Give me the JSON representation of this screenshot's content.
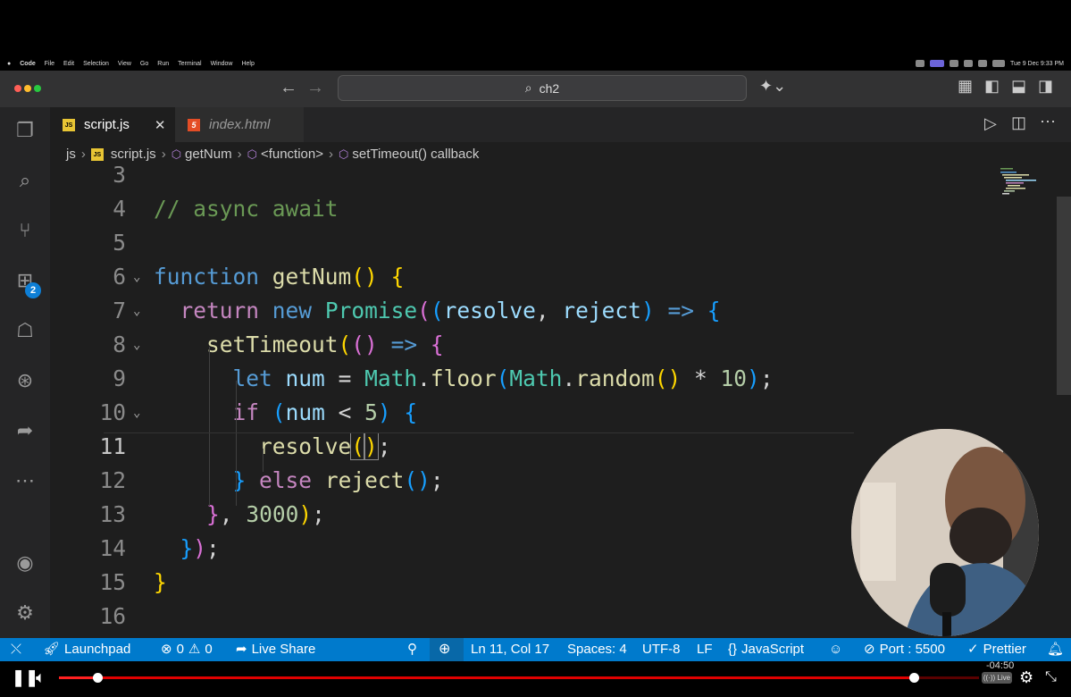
{
  "menubar": {
    "app": "Code",
    "items": [
      "File",
      "Edit",
      "Selection",
      "View",
      "Go",
      "Run",
      "Terminal",
      "Window",
      "Help"
    ],
    "clock": "Tue 9 Dec 9:33 PM"
  },
  "titlebar": {
    "search_text": "ch2"
  },
  "activity": {
    "extensions_badge": "2"
  },
  "tabs": [
    {
      "label": "script.js",
      "icon": "js-file-icon",
      "active": true,
      "close": "✕"
    },
    {
      "label": "index.html",
      "icon": "html5-file-icon",
      "active": false
    }
  ],
  "breadcrumb": [
    "js",
    "script.js",
    "getNum",
    "<function>",
    "setTimeout() callback"
  ],
  "editor": {
    "line_numbers": [
      "3",
      "4",
      "5",
      "6",
      "7",
      "8",
      "9",
      "10",
      "11",
      "12",
      "13",
      "14",
      "15",
      "16"
    ],
    "current_line": "11"
  },
  "statusbar": {
    "launchpad": "Launchpad",
    "errors": "0",
    "warnings": "0",
    "live_share": "Live Share",
    "position": "Ln 11, Col 17",
    "spaces": "Spaces: 4",
    "encoding": "UTF-8",
    "eol": "LF",
    "language": "JavaScript",
    "port": "Port : 5500",
    "prettier": "Prettier"
  },
  "player": {
    "time_remaining": "-04:50",
    "live_label": "Live",
    "progress": 0.04,
    "buffered": 0.93
  },
  "colors": {
    "statusbar": "#007acc",
    "editor_bg": "#1e1e1e",
    "keyword": "#569cd6",
    "comment": "#6a9955",
    "function": "#dcdcaa"
  }
}
